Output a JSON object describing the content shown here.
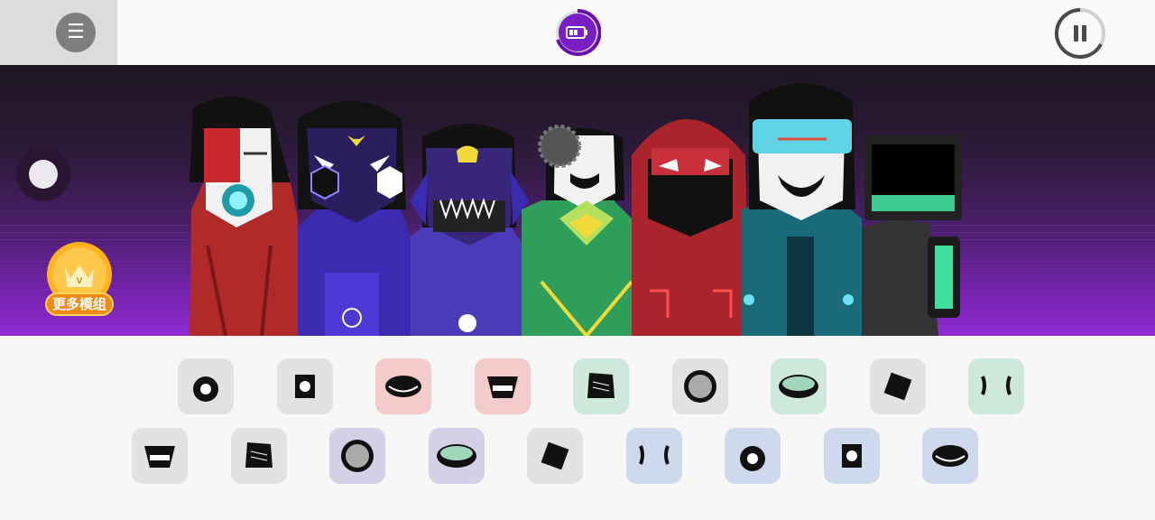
{
  "topbar": {
    "menu_icon": "hamburger-icon",
    "battery_icon": "battery-icon",
    "pause_icon": "pause-icon"
  },
  "stage": {
    "slider_icon": "slider-knob",
    "badge_label": "更多模组",
    "badge_icon": "crown-v-icon",
    "characters": [
      "red-gasmask",
      "purple-robot",
      "purple-skull",
      "green-gear",
      "red-hood",
      "cyan-visor",
      "monitor-head"
    ]
  },
  "sounds": {
    "row1": [
      {
        "color": "#e2e2e2",
        "icon": "beat-1"
      },
      {
        "color": "#e2e2e2",
        "icon": "beat-2"
      },
      {
        "color": "#f3cbcb",
        "icon": "effect-1"
      },
      {
        "color": "#f3cbcb",
        "icon": "effect-2"
      },
      {
        "color": "#cfe8dc",
        "icon": "melody-1"
      },
      {
        "color": "#e2e2e2",
        "icon": "beat-3"
      },
      {
        "color": "#cfe8dc",
        "icon": "melody-2"
      },
      {
        "color": "#e2e2e2",
        "icon": "beat-4"
      },
      {
        "color": "#cfe8dc",
        "icon": "melody-3"
      }
    ],
    "row2": [
      {
        "color": "#e2e2e2",
        "icon": "beat-5"
      },
      {
        "color": "#e2e2e2",
        "icon": "beat-6"
      },
      {
        "color": "#d4d0e6",
        "icon": "voice-1"
      },
      {
        "color": "#d4d0e6",
        "icon": "voice-2"
      },
      {
        "color": "#e2e2e2",
        "icon": "beat-7"
      },
      {
        "color": "#cfd9ee",
        "icon": "voice-3"
      },
      {
        "color": "#cfd9ee",
        "icon": "voice-4"
      },
      {
        "color": "#cfd9ee",
        "icon": "voice-5"
      },
      {
        "color": "#cfd9ee",
        "icon": "voice-6"
      }
    ]
  }
}
